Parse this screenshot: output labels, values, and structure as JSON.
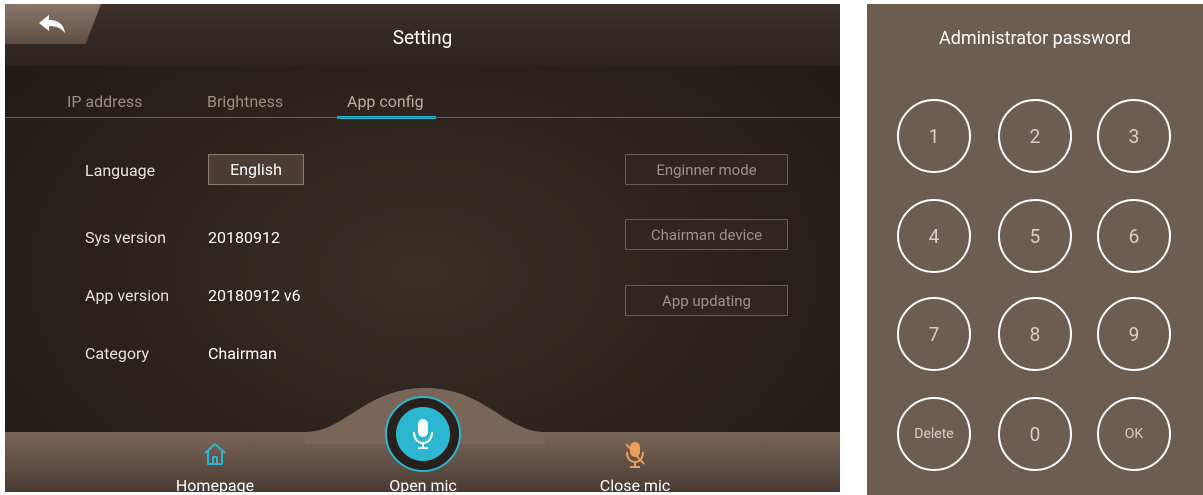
{
  "header": {
    "title": "Setting"
  },
  "tabs": [
    {
      "label": "IP address",
      "active": false
    },
    {
      "label": "Brightness",
      "active": false
    },
    {
      "label": "App config",
      "active": true
    }
  ],
  "settings": {
    "language_label": "Language",
    "language_value": "English",
    "sys_version_label": "Sys version",
    "sys_version_value": "20180912",
    "app_version_label": "App version",
    "app_version_value": "20180912 v6",
    "category_label": "Category",
    "category_value": "Chairman"
  },
  "actions": {
    "engineer_mode": "Enginner mode",
    "chairman_device": "Chairman device",
    "app_updating": "App updating"
  },
  "bottom_nav": {
    "homepage": "Homepage",
    "open_mic": "Open mic",
    "close_mic": "Close mic"
  },
  "keypad": {
    "title": "Administrator password",
    "keys": [
      "1",
      "2",
      "3",
      "4",
      "5",
      "6",
      "7",
      "8",
      "9",
      "Delete",
      "0",
      "OK"
    ]
  },
  "colors": {
    "accent": "#2bb7cf",
    "close_mic": "#e8a05a",
    "panel_bg": "#2a211c",
    "keypad_bg": "#6b5e51"
  }
}
